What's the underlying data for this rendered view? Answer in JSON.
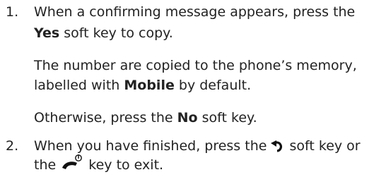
{
  "step1": {
    "number": "1.",
    "line1_pre": "When a confirming message appears, press the",
    "line2_bold": "Yes",
    "line2_post": " soft key to copy.",
    "note1_pre": "The number are copied to the phone’s memory,",
    "note1_line2_pre": "labelled with ",
    "note1_bold": "Mobile",
    "note1_post": " by default.",
    "note2_pre": "Otherwise, press the ",
    "note2_bold": "No",
    "note2_post": " soft key."
  },
  "step2": {
    "number": "2.",
    "line1_pre": "When you have finished, press the ",
    "line1_post": " soft key or",
    "line2_pre": "the ",
    "line2_post": " key to exit.",
    "back_icon": "back-arrow-icon",
    "end_key_icon": "end-power-key-icon"
  }
}
